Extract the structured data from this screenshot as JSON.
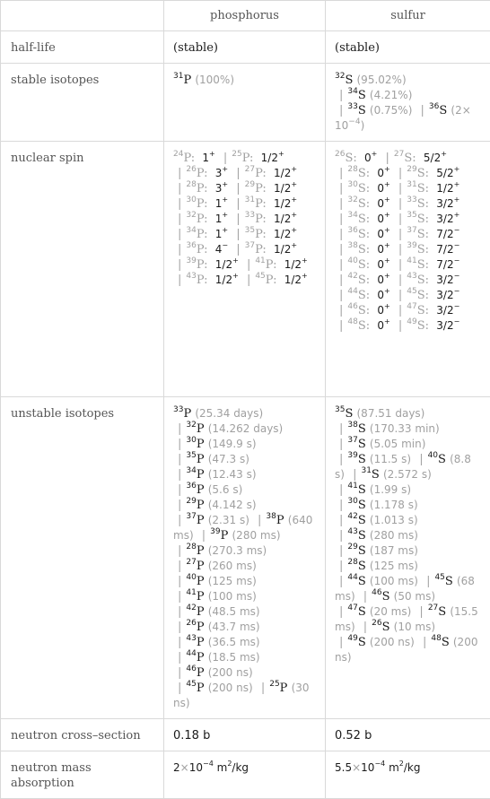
{
  "table": {
    "columns": [
      "",
      "phosphorus",
      "sulfur"
    ],
    "rows": {
      "half_life": {
        "label": "half-life",
        "phosphorus": "(stable)",
        "sulfur": "(stable)"
      },
      "stable_isotopes": {
        "label": "stable isotopes",
        "phosphorus": [
          {
            "mass": "31",
            "symbol": "P",
            "abundance": "(100%)"
          }
        ],
        "sulfur": [
          {
            "mass": "32",
            "symbol": "S",
            "abundance": "(95.02%)"
          },
          {
            "mass": "34",
            "symbol": "S",
            "abundance": "(4.21%)"
          },
          {
            "mass": "33",
            "symbol": "S",
            "abundance": "(0.75%)"
          },
          {
            "mass": "36",
            "symbol": "S",
            "abundance": "(2×10^-4)"
          }
        ]
      },
      "nuclear_spin": {
        "label": "nuclear spin",
        "phosphorus": [
          {
            "mass": "24",
            "symbol": "P",
            "spin": "1",
            "parity": "+"
          },
          {
            "mass": "25",
            "symbol": "P",
            "spin": "1/2",
            "parity": "+"
          },
          {
            "mass": "26",
            "symbol": "P",
            "spin": "3",
            "parity": "+"
          },
          {
            "mass": "27",
            "symbol": "P",
            "spin": "1/2",
            "parity": "+"
          },
          {
            "mass": "28",
            "symbol": "P",
            "spin": "3",
            "parity": "+"
          },
          {
            "mass": "29",
            "symbol": "P",
            "spin": "1/2",
            "parity": "+"
          },
          {
            "mass": "30",
            "symbol": "P",
            "spin": "1",
            "parity": "+"
          },
          {
            "mass": "31",
            "symbol": "P",
            "spin": "1/2",
            "parity": "+"
          },
          {
            "mass": "32",
            "symbol": "P",
            "spin": "1",
            "parity": "+"
          },
          {
            "mass": "33",
            "symbol": "P",
            "spin": "1/2",
            "parity": "+"
          },
          {
            "mass": "34",
            "symbol": "P",
            "spin": "1",
            "parity": "+"
          },
          {
            "mass": "35",
            "symbol": "P",
            "spin": "1/2",
            "parity": "+"
          },
          {
            "mass": "36",
            "symbol": "P",
            "spin": "4",
            "parity": "−"
          },
          {
            "mass": "37",
            "symbol": "P",
            "spin": "1/2",
            "parity": "+"
          },
          {
            "mass": "39",
            "symbol": "P",
            "spin": "1/2",
            "parity": "+"
          },
          {
            "mass": "41",
            "symbol": "P",
            "spin": "1/2",
            "parity": "+"
          },
          {
            "mass": "43",
            "symbol": "P",
            "spin": "1/2",
            "parity": "+"
          },
          {
            "mass": "45",
            "symbol": "P",
            "spin": "1/2",
            "parity": "+"
          }
        ],
        "sulfur": [
          {
            "mass": "26",
            "symbol": "S",
            "spin": "0",
            "parity": "+"
          },
          {
            "mass": "27",
            "symbol": "S",
            "spin": "5/2",
            "parity": "+"
          },
          {
            "mass": "28",
            "symbol": "S",
            "spin": "0",
            "parity": "+"
          },
          {
            "mass": "29",
            "symbol": "S",
            "spin": "5/2",
            "parity": "+"
          },
          {
            "mass": "30",
            "symbol": "S",
            "spin": "0",
            "parity": "+"
          },
          {
            "mass": "31",
            "symbol": "S",
            "spin": "1/2",
            "parity": "+"
          },
          {
            "mass": "32",
            "symbol": "S",
            "spin": "0",
            "parity": "+"
          },
          {
            "mass": "33",
            "symbol": "S",
            "spin": "3/2",
            "parity": "+"
          },
          {
            "mass": "34",
            "symbol": "S",
            "spin": "0",
            "parity": "+"
          },
          {
            "mass": "35",
            "symbol": "S",
            "spin": "3/2",
            "parity": "+"
          },
          {
            "mass": "36",
            "symbol": "S",
            "spin": "0",
            "parity": "+"
          },
          {
            "mass": "37",
            "symbol": "S",
            "spin": "7/2",
            "parity": "−"
          },
          {
            "mass": "38",
            "symbol": "S",
            "spin": "0",
            "parity": "+"
          },
          {
            "mass": "39",
            "symbol": "S",
            "spin": "7/2",
            "parity": "−"
          },
          {
            "mass": "40",
            "symbol": "S",
            "spin": "0",
            "parity": "+"
          },
          {
            "mass": "41",
            "symbol": "S",
            "spin": "7/2",
            "parity": "−"
          },
          {
            "mass": "42",
            "symbol": "S",
            "spin": "0",
            "parity": "+"
          },
          {
            "mass": "43",
            "symbol": "S",
            "spin": "3/2",
            "parity": "−"
          },
          {
            "mass": "44",
            "symbol": "S",
            "spin": "0",
            "parity": "+"
          },
          {
            "mass": "45",
            "symbol": "S",
            "spin": "3/2",
            "parity": "−"
          },
          {
            "mass": "46",
            "symbol": "S",
            "spin": "0",
            "parity": "+"
          },
          {
            "mass": "47",
            "symbol": "S",
            "spin": "3/2",
            "parity": "−"
          },
          {
            "mass": "48",
            "symbol": "S",
            "spin": "0",
            "parity": "+"
          },
          {
            "mass": "49",
            "symbol": "S",
            "spin": "3/2",
            "parity": "−"
          }
        ]
      },
      "unstable_isotopes": {
        "label": "unstable isotopes",
        "phosphorus": [
          {
            "mass": "33",
            "symbol": "P",
            "half_life": "(25.34 days)"
          },
          {
            "mass": "32",
            "symbol": "P",
            "half_life": "(14.262 days)"
          },
          {
            "mass": "30",
            "symbol": "P",
            "half_life": "(149.9 s)"
          },
          {
            "mass": "35",
            "symbol": "P",
            "half_life": "(47.3 s)"
          },
          {
            "mass": "34",
            "symbol": "P",
            "half_life": "(12.43 s)"
          },
          {
            "mass": "36",
            "symbol": "P",
            "half_life": "(5.6 s)"
          },
          {
            "mass": "29",
            "symbol": "P",
            "half_life": "(4.142 s)"
          },
          {
            "mass": "37",
            "symbol": "P",
            "half_life": "(2.31 s)"
          },
          {
            "mass": "38",
            "symbol": "P",
            "half_life": "(640 ms)"
          },
          {
            "mass": "39",
            "symbol": "P",
            "half_life": "(280 ms)"
          },
          {
            "mass": "28",
            "symbol": "P",
            "half_life": "(270.3 ms)"
          },
          {
            "mass": "27",
            "symbol": "P",
            "half_life": "(260 ms)"
          },
          {
            "mass": "40",
            "symbol": "P",
            "half_life": "(125 ms)"
          },
          {
            "mass": "41",
            "symbol": "P",
            "half_life": "(100 ms)"
          },
          {
            "mass": "42",
            "symbol": "P",
            "half_life": "(48.5 ms)"
          },
          {
            "mass": "26",
            "symbol": "P",
            "half_life": "(43.7 ms)"
          },
          {
            "mass": "43",
            "symbol": "P",
            "half_life": "(36.5 ms)"
          },
          {
            "mass": "44",
            "symbol": "P",
            "half_life": "(18.5 ms)"
          },
          {
            "mass": "46",
            "symbol": "P",
            "half_life": "(200 ns)"
          },
          {
            "mass": "45",
            "symbol": "P",
            "half_life": "(200 ns)"
          },
          {
            "mass": "25",
            "symbol": "P",
            "half_life": "(30 ns)"
          }
        ],
        "sulfur": [
          {
            "mass": "35",
            "symbol": "S",
            "half_life": "(87.51 days)"
          },
          {
            "mass": "38",
            "symbol": "S",
            "half_life": "(170.33 min)"
          },
          {
            "mass": "37",
            "symbol": "S",
            "half_life": "(5.05 min)"
          },
          {
            "mass": "39",
            "symbol": "S",
            "half_life": "(11.5 s)"
          },
          {
            "mass": "40",
            "symbol": "S",
            "half_life": "(8.8 s)"
          },
          {
            "mass": "31",
            "symbol": "S",
            "half_life": "(2.572 s)"
          },
          {
            "mass": "41",
            "symbol": "S",
            "half_life": "(1.99 s)"
          },
          {
            "mass": "30",
            "symbol": "S",
            "half_life": "(1.178 s)"
          },
          {
            "mass": "42",
            "symbol": "S",
            "half_life": "(1.013 s)"
          },
          {
            "mass": "43",
            "symbol": "S",
            "half_life": "(280 ms)"
          },
          {
            "mass": "29",
            "symbol": "S",
            "half_life": "(187 ms)"
          },
          {
            "mass": "28",
            "symbol": "S",
            "half_life": "(125 ms)"
          },
          {
            "mass": "44",
            "symbol": "S",
            "half_life": "(100 ms)"
          },
          {
            "mass": "45",
            "symbol": "S",
            "half_life": "(68 ms)"
          },
          {
            "mass": "46",
            "symbol": "S",
            "half_life": "(50 ms)"
          },
          {
            "mass": "47",
            "symbol": "S",
            "half_life": "(20 ms)"
          },
          {
            "mass": "27",
            "symbol": "S",
            "half_life": "(15.5 ms)"
          },
          {
            "mass": "26",
            "symbol": "S",
            "half_life": "(10 ms)"
          },
          {
            "mass": "49",
            "symbol": "S",
            "half_life": "(200 ns)"
          },
          {
            "mass": "48",
            "symbol": "S",
            "half_life": "(200 ns)"
          }
        ]
      },
      "neutron_cross_section": {
        "label": "neutron cross–section",
        "phosphorus": "0.18 b",
        "sulfur": "0.52 b"
      },
      "neutron_mass_absorption": {
        "label": "neutron mass absorption",
        "phosphorus": {
          "mantissa": "2",
          "exponent": "-4",
          "unit": "m",
          "unit_exp": "2",
          "unit_rest": "/kg"
        },
        "sulfur": {
          "mantissa": "5.5",
          "exponent": "-4",
          "unit": "m",
          "unit_exp": "2",
          "unit_rest": "/kg"
        }
      }
    }
  }
}
